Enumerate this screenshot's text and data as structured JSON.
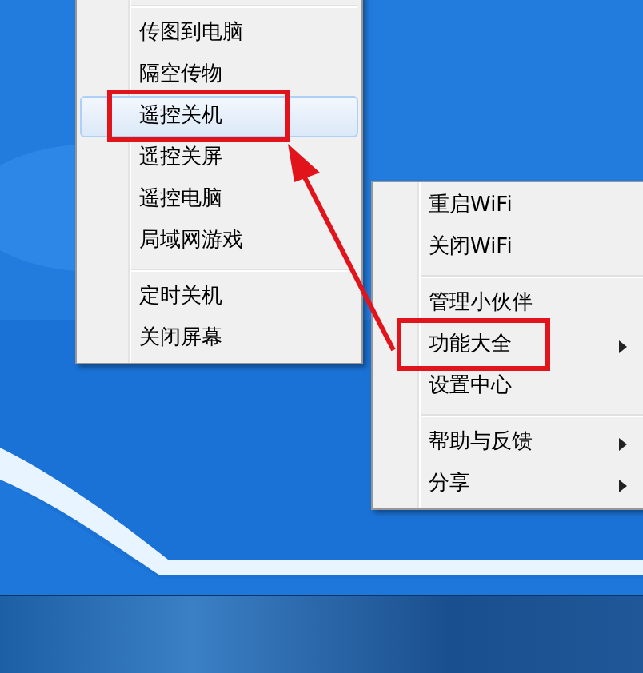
{
  "left_menu": {
    "items": [
      {
        "kind": "separator"
      },
      {
        "kind": "item",
        "label": "传图到电脑",
        "selected": false,
        "annotated": false
      },
      {
        "kind": "item",
        "label": "隔空传物",
        "selected": false,
        "annotated": false
      },
      {
        "kind": "item",
        "label": "遥控关机",
        "selected": true,
        "annotated": true
      },
      {
        "kind": "item",
        "label": "遥控关屏",
        "selected": false,
        "annotated": false
      },
      {
        "kind": "item",
        "label": "遥控电脑",
        "selected": false,
        "annotated": false
      },
      {
        "kind": "item",
        "label": "局域网游戏",
        "selected": false,
        "annotated": false
      },
      {
        "kind": "separator"
      },
      {
        "kind": "item",
        "label": "定时关机",
        "selected": false,
        "annotated": false
      },
      {
        "kind": "item",
        "label": "关闭屏幕",
        "selected": false,
        "annotated": false
      }
    ]
  },
  "right_menu": {
    "items": [
      {
        "kind": "item",
        "label": "重启WiFi",
        "submenu": false,
        "annotated": false
      },
      {
        "kind": "item",
        "label": "关闭WiFi",
        "submenu": false,
        "annotated": false
      },
      {
        "kind": "separator"
      },
      {
        "kind": "item",
        "label": "管理小伙伴",
        "submenu": false,
        "annotated": false
      },
      {
        "kind": "item",
        "label": "功能大全",
        "submenu": true,
        "annotated": true
      },
      {
        "kind": "item",
        "label": "设置中心",
        "submenu": false,
        "annotated": false
      },
      {
        "kind": "separator"
      },
      {
        "kind": "item",
        "label": "帮助与反馈",
        "submenu": true,
        "annotated": false
      },
      {
        "kind": "item",
        "label": "分享",
        "submenu": true,
        "annotated": false
      }
    ]
  }
}
